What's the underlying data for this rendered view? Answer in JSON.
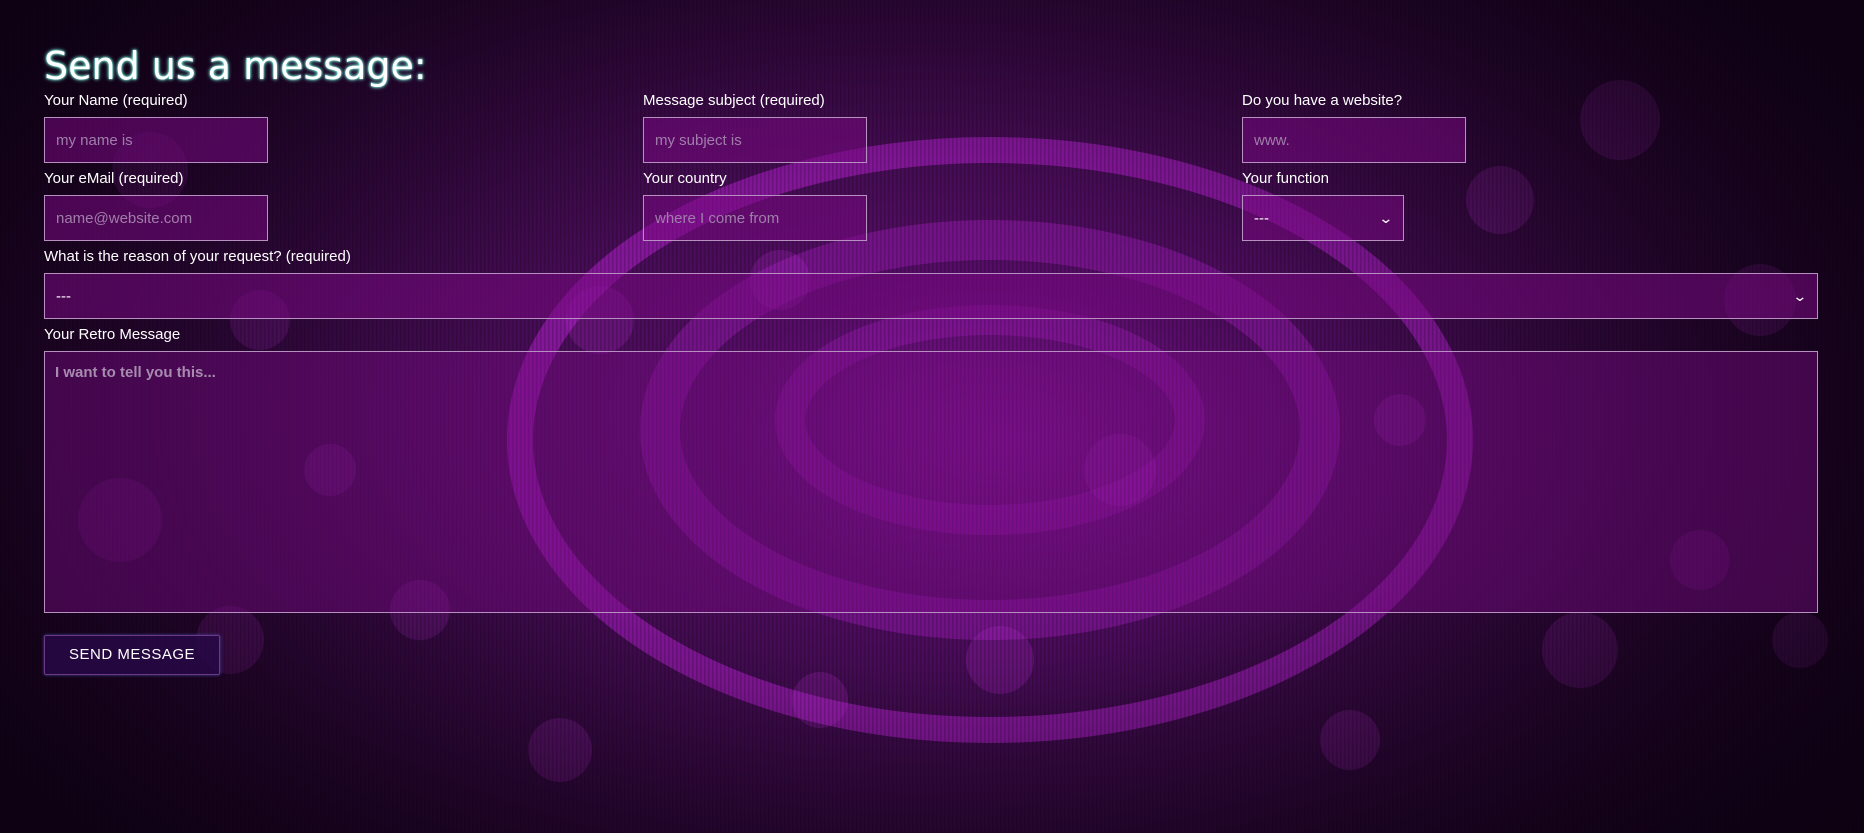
{
  "colors": {
    "accent_glow": "#7fffe8",
    "field_border": "#b78fc0",
    "background": "#3f0a4d"
  },
  "form": {
    "title": "Send us a message:",
    "name": {
      "label": "Your Name (required)",
      "placeholder": "my name is"
    },
    "subject": {
      "label": "Message subject (required)",
      "placeholder": "my subject is"
    },
    "website": {
      "label": "Do you have a website?",
      "placeholder": "www."
    },
    "email": {
      "label": "Your eMail (required)",
      "placeholder": "name@website.com"
    },
    "country": {
      "label": "Your country",
      "placeholder": "where I come from"
    },
    "function": {
      "label": "Your function",
      "selected": "---"
    },
    "reason": {
      "label": "What is the reason of your request? (required)",
      "selected": "---"
    },
    "message": {
      "label": "Your Retro Message",
      "placeholder": "I want to tell you this..."
    },
    "submit_label": "SEND MESSAGE"
  }
}
